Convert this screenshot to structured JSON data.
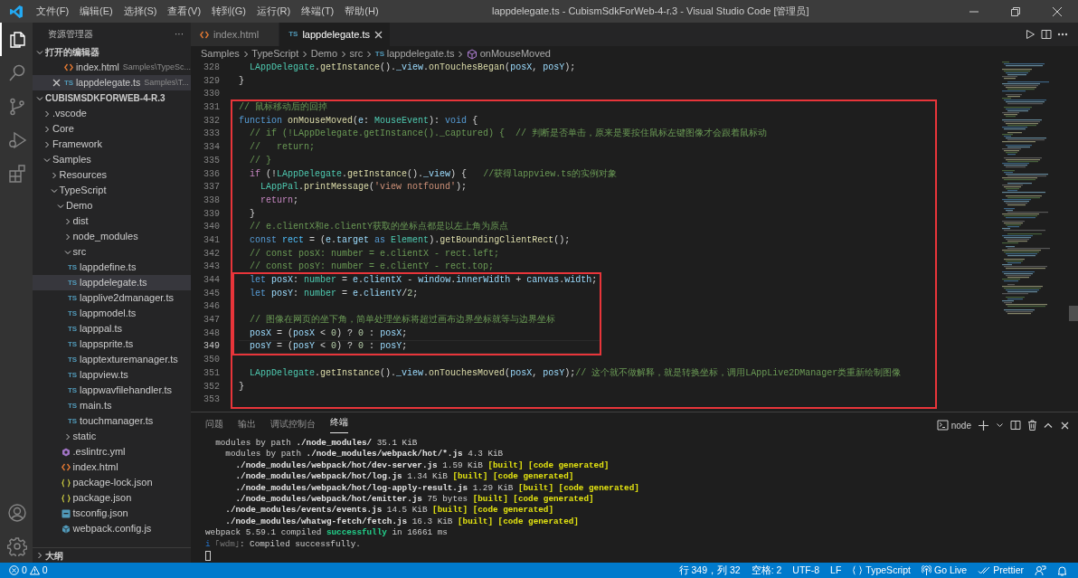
{
  "title_bar": {
    "menu": [
      "文件(F)",
      "编辑(E)",
      "选择(S)",
      "查看(V)",
      "转到(G)",
      "运行(R)",
      "终端(T)",
      "帮助(H)"
    ],
    "title": "lappdelegate.ts - CubismSdkForWeb-4-r.3 - Visual Studio Code [管理员]"
  },
  "activity_bar": [
    {
      "selected": true
    },
    {
      "selected": false
    },
    {
      "selected": false
    },
    {
      "selected": false
    },
    {
      "selected": false
    }
  ],
  "sidebar": {
    "title": "资源管理器",
    "more": "···",
    "open_editors": {
      "title": "打开的编辑器",
      "expanded": true,
      "items": [
        {
          "kind": "html",
          "name": "index.html",
          "path": "Samples\\TypeSc...",
          "selected": false,
          "closable": false
        },
        {
          "kind": "ts",
          "type_label": "TS",
          "name": "lappdelegate.ts",
          "path": "Samples\\T...",
          "selected": true,
          "closable": true
        }
      ]
    },
    "workspace": {
      "title": "CUBISMSDKFORWEB-4-R.3",
      "expanded": true,
      "items": [
        {
          "kind": "folder",
          "name": ".vscode",
          "expanded": false,
          "selected": false
        },
        {
          "kind": "folder",
          "name": "Core",
          "expanded": false,
          "selected": false
        },
        {
          "kind": "folder",
          "name": "Framework",
          "expanded": false,
          "selected": false
        },
        {
          "kind": "folder",
          "name": "Samples",
          "expanded": true,
          "selected": false,
          "children": [
            {
              "kind": "folder",
              "name": "Resources",
              "expanded": false,
              "selected": false
            },
            {
              "kind": "folder",
              "name": "TypeScript",
              "expanded": true,
              "selected": false,
              "children": [
                {
                  "kind": "folder",
                  "name": "Demo",
                  "expanded": true,
                  "selected": false,
                  "children": [
                    {
                      "kind": "folder",
                      "name": "dist",
                      "expanded": false,
                      "selected": false
                    },
                    {
                      "kind": "folder",
                      "name": "node_modules",
                      "expanded": false,
                      "selected": false
                    },
                    {
                      "kind": "folder",
                      "name": "src",
                      "expanded": true,
                      "selected": false,
                      "children": [
                        {
                          "kind": "ts",
                          "type_label": "TS",
                          "name": "lappdefine.ts",
                          "selected": false
                        },
                        {
                          "kind": "ts",
                          "type_label": "TS",
                          "name": "lappdelegate.ts",
                          "selected": true
                        },
                        {
                          "kind": "ts",
                          "type_label": "TS",
                          "name": "lapplive2dmanager.ts",
                          "selected": false
                        },
                        {
                          "kind": "ts",
                          "type_label": "TS",
                          "name": "lappmodel.ts",
                          "selected": false
                        },
                        {
                          "kind": "ts",
                          "type_label": "TS",
                          "name": "lapppal.ts",
                          "selected": false
                        },
                        {
                          "kind": "ts",
                          "type_label": "TS",
                          "name": "lappsprite.ts",
                          "selected": false
                        },
                        {
                          "kind": "ts",
                          "type_label": "TS",
                          "name": "lapptexturemanager.ts",
                          "selected": false
                        },
                        {
                          "kind": "ts",
                          "type_label": "TS",
                          "name": "lappview.ts",
                          "selected": false
                        },
                        {
                          "kind": "ts",
                          "type_label": "TS",
                          "name": "lappwavfilehandler.ts",
                          "selected": false
                        },
                        {
                          "kind": "ts",
                          "type_label": "TS",
                          "name": "main.ts",
                          "selected": false
                        },
                        {
                          "kind": "ts",
                          "type_label": "TS",
                          "name": "touchmanager.ts",
                          "selected": false
                        }
                      ]
                    },
                    {
                      "kind": "folder",
                      "name": "static",
                      "expanded": false,
                      "selected": false
                    },
                    {
                      "kind": "yml",
                      "name": ".eslintrc.yml",
                      "selected": false
                    },
                    {
                      "kind": "html",
                      "name": "index.html",
                      "selected": false
                    },
                    {
                      "kind": "json",
                      "name": "package-lock.json",
                      "selected": false
                    },
                    {
                      "kind": "json",
                      "name": "package.json",
                      "selected": false
                    },
                    {
                      "kind": "tsconfig",
                      "name": "tsconfig.json",
                      "selected": false
                    },
                    {
                      "kind": "js",
                      "name": "webpack.config.js",
                      "selected": false
                    }
                  ]
                }
              ]
            }
          ]
        }
      ]
    },
    "outline": {
      "title": "大纲",
      "expanded": false
    }
  },
  "editor": {
    "tabs": [
      {
        "kind": "html",
        "label": "index.html",
        "selected": false
      },
      {
        "kind": "ts",
        "type_label": "TS",
        "label": "lappdelegate.ts",
        "selected": true
      }
    ],
    "breadcrumbs": [
      {
        "kind": "folder",
        "text": "Samples"
      },
      {
        "kind": "folder",
        "text": "TypeScript"
      },
      {
        "kind": "folder",
        "text": "Demo"
      },
      {
        "kind": "folder",
        "text": "src"
      },
      {
        "kind": "ts",
        "type_label": "TS",
        "text": "lappdelegate.ts"
      },
      {
        "kind": "symbol",
        "text": "onMouseMoved"
      }
    ],
    "lines": [
      {
        "number": "328",
        "current": false,
        "tokens": [
          {
            "kind": "class",
            "text": "  LAppDelegate"
          },
          {
            "kind": "plain",
            "text": "."
          },
          {
            "kind": "function",
            "text": "getInstance"
          },
          {
            "kind": "plain",
            "text": "()."
          },
          {
            "kind": "variable",
            "text": "_view"
          },
          {
            "kind": "plain",
            "text": "."
          },
          {
            "kind": "function",
            "text": "onTouchesBegan"
          },
          {
            "kind": "plain",
            "text": "("
          },
          {
            "kind": "variable",
            "text": "posX"
          },
          {
            "kind": "plain",
            "text": ", "
          },
          {
            "kind": "variable",
            "text": "posY"
          },
          {
            "kind": "plain",
            "text": ");"
          }
        ]
      },
      {
        "number": "329",
        "current": false,
        "tokens": [
          {
            "kind": "plain",
            "text": "}"
          }
        ]
      },
      {
        "number": "330",
        "current": false
      }
    ],
    "frame": {
      "lines_before": [
        {
          "number": "331",
          "current": false,
          "tokens": [
            {
              "kind": "comment",
              "text": "// 鼠标移动后的回掉"
            }
          ]
        },
        {
          "number": "332",
          "current": false,
          "tokens": [
            {
              "kind": "keyword",
              "text": "function "
            },
            {
              "kind": "function",
              "text": "onMouseMoved"
            },
            {
              "kind": "plain",
              "text": "("
            },
            {
              "kind": "variable",
              "text": "e"
            },
            {
              "kind": "plain",
              "text": ": "
            },
            {
              "kind": "type",
              "text": "MouseEvent"
            },
            {
              "kind": "plain",
              "text": "): "
            },
            {
              "kind": "keyword",
              "text": "void"
            },
            {
              "kind": "plain",
              "text": " {"
            }
          ]
        },
        {
          "number": "333",
          "current": false,
          "tokens": [
            {
              "kind": "comment",
              "text": "  // if (!LAppDelegate.getInstance()._captured) {  // 判断是否单击，原来是要按住鼠标左键图像才会跟着鼠标动"
            }
          ]
        },
        {
          "number": "334",
          "current": false,
          "tokens": [
            {
              "kind": "comment",
              "text": "  //   return;"
            }
          ]
        },
        {
          "number": "335",
          "current": false,
          "tokens": [
            {
              "kind": "comment",
              "text": "  // }"
            }
          ]
        },
        {
          "number": "336",
          "current": false,
          "tokens": [
            {
              "kind": "control",
              "text": "  if"
            },
            {
              "kind": "plain",
              "text": " (!"
            },
            {
              "kind": "class",
              "text": "LAppDelegate"
            },
            {
              "kind": "plain",
              "text": "."
            },
            {
              "kind": "function",
              "text": "getInstance"
            },
            {
              "kind": "plain",
              "text": "()."
            },
            {
              "kind": "variable",
              "text": "_view"
            },
            {
              "kind": "plain",
              "text": ") {   "
            },
            {
              "kind": "comment",
              "text": "//获得lappview.ts的实例对象"
            }
          ]
        },
        {
          "number": "337",
          "current": false,
          "tokens": [
            {
              "kind": "class",
              "text": "    LAppPal"
            },
            {
              "kind": "plain",
              "text": "."
            },
            {
              "kind": "function",
              "text": "printMessage"
            },
            {
              "kind": "plain",
              "text": "("
            },
            {
              "kind": "string",
              "text": "'view notfound'"
            },
            {
              "kind": "plain",
              "text": ");"
            }
          ]
        },
        {
          "number": "338",
          "current": false,
          "tokens": [
            {
              "kind": "control",
              "text": "    return"
            },
            {
              "kind": "plain",
              "text": ";"
            }
          ]
        },
        {
          "number": "339",
          "current": false,
          "tokens": [
            {
              "kind": "plain",
              "text": "  }"
            }
          ]
        },
        {
          "number": "340",
          "current": false,
          "tokens": [
            {
              "kind": "comment",
              "text": "  // e.clientX和e.clientY获取的坐标点都是以左上角为原点"
            }
          ]
        },
        {
          "number": "341",
          "current": false,
          "tokens": [
            {
              "kind": "keyword",
              "text": "  const "
            },
            {
              "kind": "constant",
              "text": "rect"
            },
            {
              "kind": "plain",
              "text": " = ("
            },
            {
              "kind": "variable",
              "text": "e"
            },
            {
              "kind": "plain",
              "text": "."
            },
            {
              "kind": "variable",
              "text": "target "
            },
            {
              "kind": "keyword",
              "text": "as "
            },
            {
              "kind": "type",
              "text": "Element"
            },
            {
              "kind": "plain",
              "text": ")."
            },
            {
              "kind": "function",
              "text": "getBoundingClientRect"
            },
            {
              "kind": "plain",
              "text": "();"
            }
          ]
        },
        {
          "number": "342",
          "current": false,
          "tokens": [
            {
              "kind": "comment",
              "text": "  // const posX: number = e.clientX - rect.left;"
            }
          ]
        },
        {
          "number": "343",
          "current": false,
          "tokens": [
            {
              "kind": "comment",
              "text": "  // const posY: number = e.clientY - rect.top;"
            }
          ]
        }
      ],
      "inner_frame": {
        "lines": [
          {
            "number": "344",
            "current": false,
            "tokens": [
              {
                "kind": "keyword",
                "text": "  let "
              },
              {
                "kind": "variable",
                "text": "posX"
              },
              {
                "kind": "plain",
                "text": ": "
              },
              {
                "kind": "type",
                "text": "number"
              },
              {
                "kind": "plain",
                "text": " = "
              },
              {
                "kind": "variable",
                "text": "e"
              },
              {
                "kind": "plain",
                "text": "."
              },
              {
                "kind": "variable",
                "text": "clientX"
              },
              {
                "kind": "plain",
                "text": " - "
              },
              {
                "kind": "variable",
                "text": "window"
              },
              {
                "kind": "plain",
                "text": "."
              },
              {
                "kind": "variable",
                "text": "innerWidth"
              },
              {
                "kind": "plain",
                "text": " + "
              },
              {
                "kind": "variable",
                "text": "canvas"
              },
              {
                "kind": "plain",
                "text": "."
              },
              {
                "kind": "variable",
                "text": "width"
              },
              {
                "kind": "plain",
                "text": ";"
              }
            ]
          },
          {
            "number": "345",
            "current": false,
            "tokens": [
              {
                "kind": "keyword",
                "text": "  let "
              },
              {
                "kind": "variable",
                "text": "posY"
              },
              {
                "kind": "plain",
                "text": ": "
              },
              {
                "kind": "type",
                "text": "number"
              },
              {
                "kind": "plain",
                "text": " = "
              },
              {
                "kind": "variable",
                "text": "e"
              },
              {
                "kind": "plain",
                "text": "."
              },
              {
                "kind": "variable",
                "text": "clientY"
              },
              {
                "kind": "plain",
                "text": "/"
              },
              {
                "kind": "number",
                "text": "2"
              },
              {
                "kind": "plain",
                "text": ";"
              }
            ]
          },
          {
            "number": "346",
            "current": false
          },
          {
            "number": "347",
            "current": false,
            "tokens": [
              {
                "kind": "comment",
                "text": "  // 图像在网页的坐下角，简单处理坐标将超过画布边界坐标就等与边界坐标"
              }
            ]
          },
          {
            "number": "348",
            "current": false,
            "tokens": [
              {
                "kind": "variable",
                "text": "  posX"
              },
              {
                "kind": "plain",
                "text": " = ("
              },
              {
                "kind": "variable",
                "text": "posX"
              },
              {
                "kind": "plain",
                "text": " < "
              },
              {
                "kind": "number",
                "text": "0"
              },
              {
                "kind": "plain",
                "text": ") ? "
              },
              {
                "kind": "number",
                "text": "0"
              },
              {
                "kind": "plain",
                "text": " : "
              },
              {
                "kind": "variable",
                "text": "posX"
              },
              {
                "kind": "plain",
                "text": ";"
              }
            ]
          },
          {
            "number": "349",
            "current": true,
            "tokens": [
              {
                "kind": "variable",
                "text": "  posY"
              },
              {
                "kind": "plain",
                "text": " = ("
              },
              {
                "kind": "variable",
                "text": "posY"
              },
              {
                "kind": "plain",
                "text": " < "
              },
              {
                "kind": "number",
                "text": "0"
              },
              {
                "kind": "plain",
                "text": ") ? "
              },
              {
                "kind": "number",
                "text": "0"
              },
              {
                "kind": "plain",
                "text": " : "
              },
              {
                "kind": "variable",
                "text": "posY"
              },
              {
                "kind": "plain",
                "text": ";"
              }
            ]
          }
        ]
      },
      "lines_after": [
        {
          "number": "350",
          "current": false
        },
        {
          "number": "351",
          "current": false,
          "tokens": [
            {
              "kind": "class",
              "text": "  LAppDelegate"
            },
            {
              "kind": "plain",
              "text": "."
            },
            {
              "kind": "function",
              "text": "getInstance"
            },
            {
              "kind": "plain",
              "text": "()."
            },
            {
              "kind": "variable",
              "text": "_view"
            },
            {
              "kind": "plain",
              "text": "."
            },
            {
              "kind": "function",
              "text": "onTouchesMoved"
            },
            {
              "kind": "plain",
              "text": "("
            },
            {
              "kind": "variable",
              "text": "posX"
            },
            {
              "kind": "plain",
              "text": ", "
            },
            {
              "kind": "variable",
              "text": "posY"
            },
            {
              "kind": "plain",
              "text": ");"
            },
            {
              "kind": "comment",
              "text": "// 这个就不做解释，就是转换坐标，调用LAppLive2DManager类重新绘制图像"
            }
          ]
        },
        {
          "number": "352",
          "current": false,
          "tokens": [
            {
              "kind": "plain",
              "text": "}"
            }
          ]
        },
        {
          "number": "353",
          "current": false
        }
      ]
    }
  },
  "panel": {
    "tabs": [
      {
        "label": "问题",
        "selected": false
      },
      {
        "label": "输出",
        "selected": false
      },
      {
        "label": "调试控制台",
        "selected": false
      },
      {
        "label": "终端",
        "selected": true
      }
    ],
    "terminal_name": "node",
    "terminal_lines": [
      [
        {
          "kind": "plain",
          "text": "  modules by path "
        },
        {
          "kind": "bold",
          "text": "./node_modules/"
        },
        {
          "kind": "plain",
          "text": " 35.1 KiB"
        }
      ],
      [
        {
          "kind": "plain",
          "text": "    modules by path "
        },
        {
          "kind": "bold",
          "text": "./node_modules/webpack/hot/*.js"
        },
        {
          "kind": "plain",
          "text": " 4.3 KiB"
        }
      ],
      [
        {
          "kind": "bold",
          "text": "      ./node_modules/webpack/hot/dev-server.js"
        },
        {
          "kind": "plain",
          "text": " 1.59 KiB "
        },
        {
          "kind": "built",
          "text": "[built] [code generated]"
        }
      ],
      [
        {
          "kind": "bold",
          "text": "      ./node_modules/webpack/hot/log.js"
        },
        {
          "kind": "plain",
          "text": " 1.34 KiB "
        },
        {
          "kind": "built",
          "text": "[built] [code generated]"
        }
      ],
      [
        {
          "kind": "bold",
          "text": "      ./node_modules/webpack/hot/log-apply-result.js"
        },
        {
          "kind": "plain",
          "text": " 1.29 KiB "
        },
        {
          "kind": "built",
          "text": "[built] [code generated]"
        }
      ],
      [
        {
          "kind": "bold",
          "text": "      ./node_modules/webpack/hot/emitter.js"
        },
        {
          "kind": "plain",
          "text": " 75 bytes "
        },
        {
          "kind": "built",
          "text": "[built] [code generated]"
        }
      ],
      [
        {
          "kind": "bold",
          "text": "    ./node_modules/events/events.js"
        },
        {
          "kind": "plain",
          "text": " 14.5 KiB "
        },
        {
          "kind": "built",
          "text": "[built] [code generated]"
        }
      ],
      [
        {
          "kind": "bold",
          "text": "    ./node_modules/whatwg-fetch/fetch.js"
        },
        {
          "kind": "plain",
          "text": " 16.3 KiB "
        },
        {
          "kind": "built",
          "text": "[built] [code generated]"
        }
      ],
      [
        {
          "kind": "plain",
          "text": "webpack 5.59.1 compiled "
        },
        {
          "kind": "success",
          "text": "successfully"
        },
        {
          "kind": "plain",
          "text": " in 16661 ms"
        }
      ],
      [
        {
          "kind": "info",
          "text": "i "
        },
        {
          "kind": "dim",
          "text": "｢wdm｣"
        },
        {
          "kind": "plain",
          "text": ": Compiled successfully."
        }
      ]
    ],
    "cursor": true
  },
  "status_bar": {
    "errors": "0",
    "warnings": "0",
    "items": [
      {
        "kind": "text",
        "text": "行 349，列 32"
      },
      {
        "kind": "text",
        "text": "空格: 2"
      },
      {
        "kind": "text",
        "text": "UTF-8"
      },
      {
        "kind": "text",
        "text": "LF"
      },
      {
        "kind": "language",
        "text": "TypeScript"
      },
      {
        "kind": "live",
        "text": "Go Live"
      },
      {
        "kind": "prettier",
        "text": "Prettier"
      },
      {
        "kind": "feedback"
      },
      {
        "kind": "bell"
      }
    ]
  }
}
